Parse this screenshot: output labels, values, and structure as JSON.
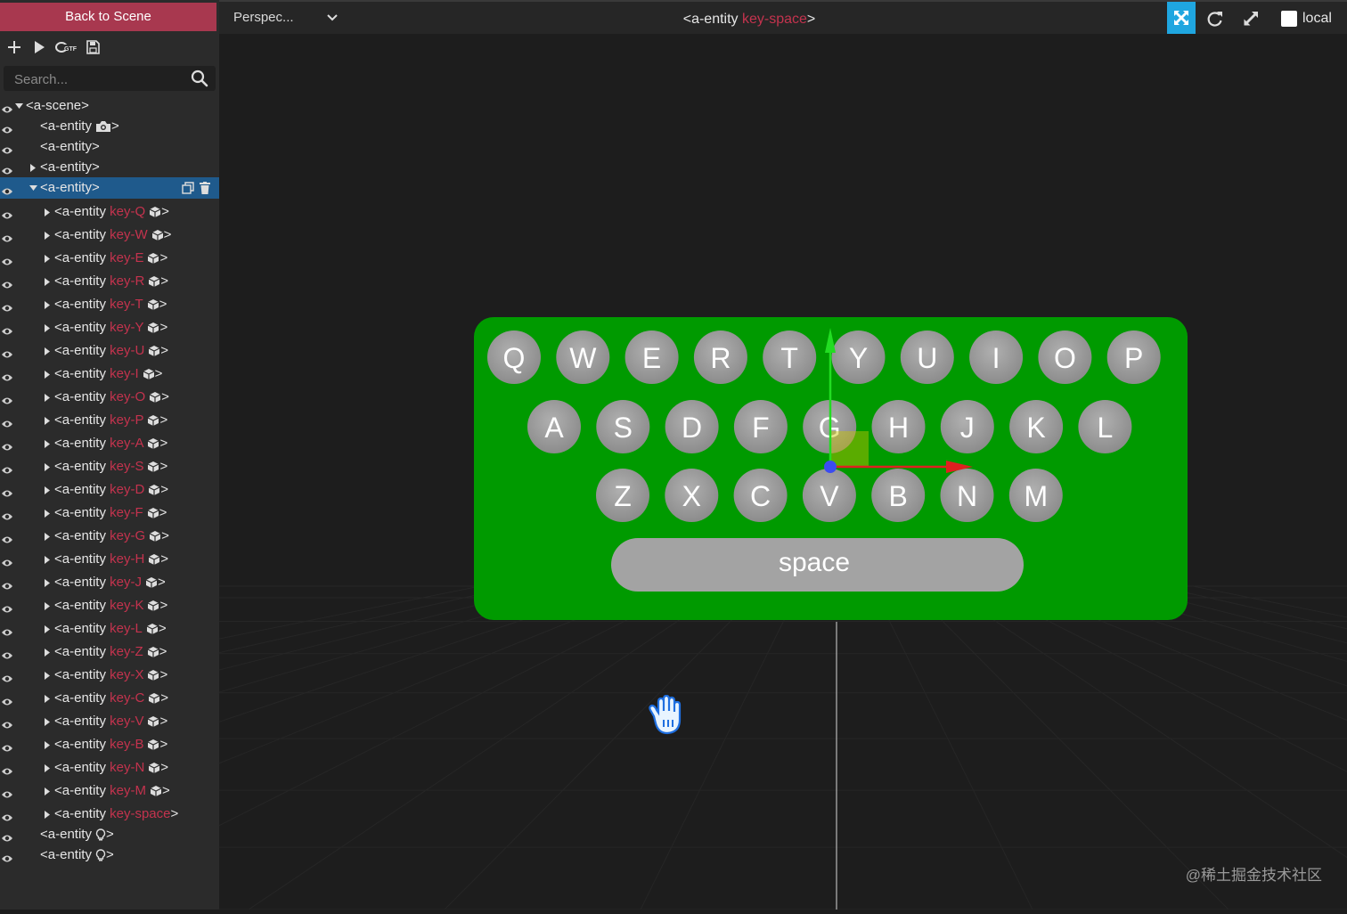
{
  "left_panel": {
    "back_label": "Back to Scene",
    "search_placeholder": "Search...",
    "tree": [
      {
        "indent": 0,
        "expanded": true,
        "caret": true,
        "tag": "<a-scene>",
        "key": "",
        "suffix": "",
        "icon": ""
      },
      {
        "indent": 1,
        "caret": false,
        "tag": "<a-entity",
        "key": "",
        "suffix": ">",
        "icon": "camera-icon"
      },
      {
        "indent": 1,
        "caret": false,
        "tag": "<a-entity>",
        "key": "",
        "suffix": "",
        "icon": ""
      },
      {
        "indent": 1,
        "expanded": false,
        "caret": true,
        "tag": "<a-entity>",
        "key": "",
        "suffix": "",
        "icon": ""
      },
      {
        "indent": 1,
        "expanded": true,
        "caret": true,
        "tag": "<a-entity>",
        "key": "",
        "suffix": "",
        "icon": "",
        "selected": true
      },
      {
        "indent": 2,
        "caret": true,
        "tag": "<a-entity",
        "key": "key-Q",
        "suffix": ">",
        "icon": "cube-icon"
      },
      {
        "indent": 2,
        "caret": true,
        "tag": "<a-entity",
        "key": "key-W",
        "suffix": ">",
        "icon": "cube-icon"
      },
      {
        "indent": 2,
        "caret": true,
        "tag": "<a-entity",
        "key": "key-E",
        "suffix": ">",
        "icon": "cube-icon"
      },
      {
        "indent": 2,
        "caret": true,
        "tag": "<a-entity",
        "key": "key-R",
        "suffix": ">",
        "icon": "cube-icon"
      },
      {
        "indent": 2,
        "caret": true,
        "tag": "<a-entity",
        "key": "key-T",
        "suffix": ">",
        "icon": "cube-icon"
      },
      {
        "indent": 2,
        "caret": true,
        "tag": "<a-entity",
        "key": "key-Y",
        "suffix": ">",
        "icon": "cube-icon"
      },
      {
        "indent": 2,
        "caret": true,
        "tag": "<a-entity",
        "key": "key-U",
        "suffix": ">",
        "icon": "cube-icon"
      },
      {
        "indent": 2,
        "caret": true,
        "tag": "<a-entity",
        "key": "key-I",
        "suffix": ">",
        "icon": "cube-icon"
      },
      {
        "indent": 2,
        "caret": true,
        "tag": "<a-entity",
        "key": "key-O",
        "suffix": ">",
        "icon": "cube-icon"
      },
      {
        "indent": 2,
        "caret": true,
        "tag": "<a-entity",
        "key": "key-P",
        "suffix": ">",
        "icon": "cube-icon"
      },
      {
        "indent": 2,
        "caret": true,
        "tag": "<a-entity",
        "key": "key-A",
        "suffix": ">",
        "icon": "cube-icon"
      },
      {
        "indent": 2,
        "caret": true,
        "tag": "<a-entity",
        "key": "key-S",
        "suffix": ">",
        "icon": "cube-icon"
      },
      {
        "indent": 2,
        "caret": true,
        "tag": "<a-entity",
        "key": "key-D",
        "suffix": ">",
        "icon": "cube-icon"
      },
      {
        "indent": 2,
        "caret": true,
        "tag": "<a-entity",
        "key": "key-F",
        "suffix": ">",
        "icon": "cube-icon"
      },
      {
        "indent": 2,
        "caret": true,
        "tag": "<a-entity",
        "key": "key-G",
        "suffix": ">",
        "icon": "cube-icon"
      },
      {
        "indent": 2,
        "caret": true,
        "tag": "<a-entity",
        "key": "key-H",
        "suffix": ">",
        "icon": "cube-icon"
      },
      {
        "indent": 2,
        "caret": true,
        "tag": "<a-entity",
        "key": "key-J",
        "suffix": ">",
        "icon": "cube-icon"
      },
      {
        "indent": 2,
        "caret": true,
        "tag": "<a-entity",
        "key": "key-K",
        "suffix": ">",
        "icon": "cube-icon"
      },
      {
        "indent": 2,
        "caret": true,
        "tag": "<a-entity",
        "key": "key-L",
        "suffix": ">",
        "icon": "cube-icon"
      },
      {
        "indent": 2,
        "caret": true,
        "tag": "<a-entity",
        "key": "key-Z",
        "suffix": ">",
        "icon": "cube-icon"
      },
      {
        "indent": 2,
        "caret": true,
        "tag": "<a-entity",
        "key": "key-X",
        "suffix": ">",
        "icon": "cube-icon"
      },
      {
        "indent": 2,
        "caret": true,
        "tag": "<a-entity",
        "key": "key-C",
        "suffix": ">",
        "icon": "cube-icon"
      },
      {
        "indent": 2,
        "caret": true,
        "tag": "<a-entity",
        "key": "key-V",
        "suffix": ">",
        "icon": "cube-icon"
      },
      {
        "indent": 2,
        "caret": true,
        "tag": "<a-entity",
        "key": "key-B",
        "suffix": ">",
        "icon": "cube-icon"
      },
      {
        "indent": 2,
        "caret": true,
        "tag": "<a-entity",
        "key": "key-N",
        "suffix": ">",
        "icon": "cube-icon"
      },
      {
        "indent": 2,
        "caret": true,
        "tag": "<a-entity",
        "key": "key-M",
        "suffix": ">",
        "icon": "cube-icon"
      },
      {
        "indent": 2,
        "caret": true,
        "tag": "<a-entity",
        "key": "key-space",
        "suffix": ">",
        "icon": ""
      },
      {
        "indent": 1,
        "caret": false,
        "tag": "<a-entity",
        "key": "",
        "suffix": ">",
        "icon": "light-icon"
      },
      {
        "indent": 1,
        "caret": false,
        "tag": "<a-entity",
        "key": "",
        "suffix": ">",
        "icon": "light-icon"
      }
    ]
  },
  "toolbar": {
    "camera_mode": "Perspec...",
    "title_prefix": "<a-entity ",
    "title_key": "key-space",
    "title_suffix": ">",
    "local_label": "local"
  },
  "keyboard": {
    "row1": [
      "Q",
      "W",
      "E",
      "R",
      "T",
      "Y",
      "U",
      "I",
      "O",
      "P"
    ],
    "row2": [
      "A",
      "S",
      "D",
      "F",
      "G",
      "H",
      "J",
      "K",
      "L"
    ],
    "row3": [
      "Z",
      "X",
      "C",
      "V",
      "B",
      "N",
      "M"
    ],
    "space_label": "space"
  },
  "colors": {
    "accent": "#1fa6e0",
    "back_button": "#a8384f",
    "selection": "#1f5a8c",
    "key_text": "#c4334e",
    "board": "#009a00",
    "key_fill": "#9e9e9e"
  },
  "watermark": "@稀土掘金技术社区"
}
